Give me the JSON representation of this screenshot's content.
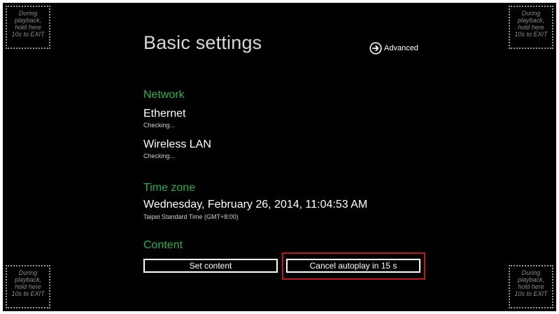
{
  "colors": {
    "background": "#000000",
    "section_heading": "#26b34a",
    "highlight": "#c0161d"
  },
  "corner_hint": [
    "During",
    "playback,",
    "hold here",
    "10s to EXIT"
  ],
  "header": {
    "title": "Basic settings",
    "advanced_label": "Advanced",
    "advanced_icon": "arrow-right-circle-icon"
  },
  "network": {
    "heading": "Network",
    "ethernet": {
      "label": "Ethernet",
      "status": "Checking..."
    },
    "wireless": {
      "label": "Wireless LAN",
      "status": "Checking..."
    }
  },
  "timezone": {
    "heading": "Time zone",
    "datetime": "Wednesday, February 26, 2014, 11:04:53 AM",
    "zone": "Taipei Standard Time (GMT+8:00)"
  },
  "content": {
    "heading": "Content",
    "set_content_label": "Set content",
    "cancel_autoplay_label": "Cancel autoplay in 15 s"
  }
}
